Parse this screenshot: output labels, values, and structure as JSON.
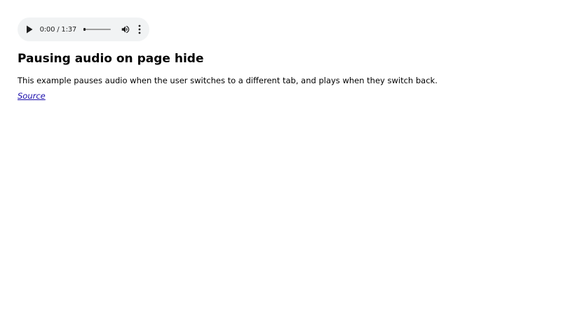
{
  "audio_player": {
    "current_time": "0:00",
    "separator": "/",
    "duration": "1:37",
    "progress": 0.02,
    "icons": {
      "play": "play-icon",
      "volume": "volume-icon",
      "menu": "more-vert-icon"
    }
  },
  "content": {
    "title": "Pausing audio on page hide",
    "description": "This example pauses audio when the user switches to a different tab, and plays when they switch back.",
    "source_link": "Source"
  },
  "colors": {
    "player_bg": "#f1f3f4",
    "link": "#1a0dab",
    "text": "#000000"
  }
}
